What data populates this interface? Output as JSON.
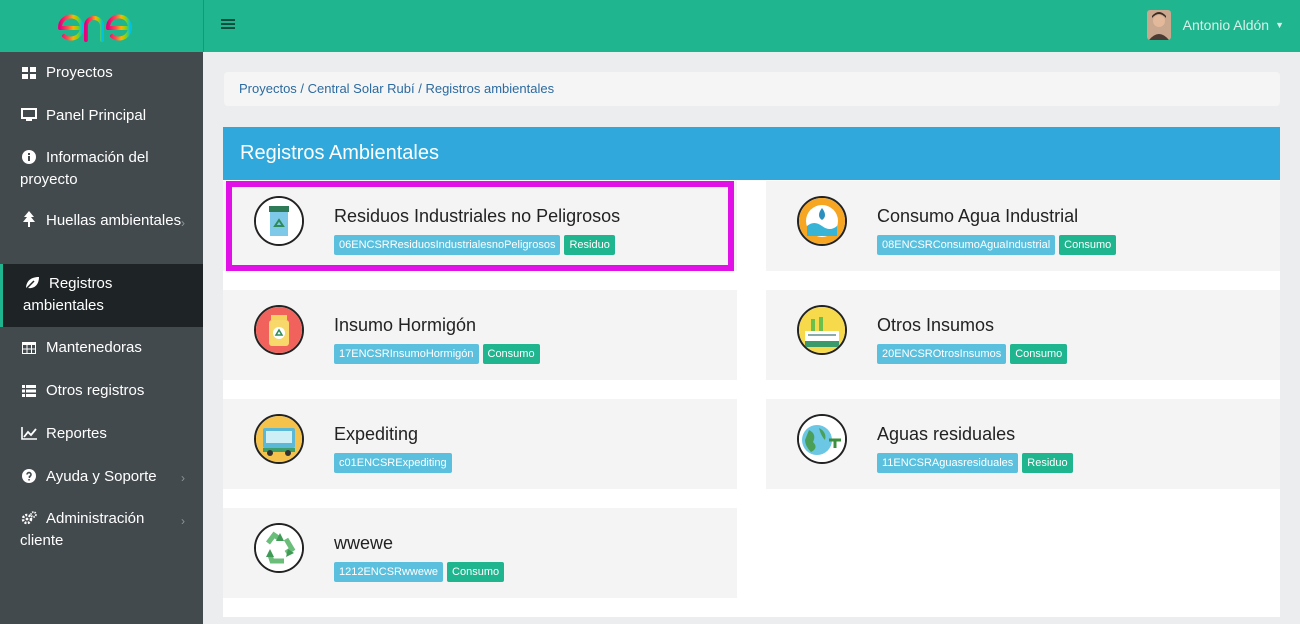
{
  "app": {
    "logo_text": "enel"
  },
  "topbar": {
    "user_name": "Antonio Aldón"
  },
  "sidebar": {
    "items": [
      {
        "label": "Proyectos",
        "icon": "grid-icon"
      },
      {
        "label": "Panel Principal",
        "icon": "monitor-icon"
      },
      {
        "label": "Información del proyecto",
        "icon": "info-icon"
      },
      {
        "label": "Huellas ambientales",
        "icon": "tree-icon"
      },
      {
        "label": "Registros ambientales",
        "icon": "leaf-icon"
      },
      {
        "label": "Mantenedoras",
        "icon": "table-icon"
      },
      {
        "label": "Otros registros",
        "icon": "list-icon"
      },
      {
        "label": "Reportes",
        "icon": "line-chart-icon"
      },
      {
        "label": "Ayuda y Soporte",
        "icon": "question-icon"
      },
      {
        "label": "Administración cliente",
        "icon": "gears-icon"
      }
    ]
  },
  "breadcrumb": {
    "items": [
      "Proyectos",
      "Central Solar Rubí",
      "Registros ambientales"
    ],
    "separator": " / "
  },
  "panel": {
    "title": "Registros Ambientales"
  },
  "records": [
    {
      "title": "Residuos Industriales no Peligrosos",
      "code": "06ENCSRResiduosIndustrialesnoPeligrosos",
      "type": "Residuo",
      "icon": "recycle-bin-icon"
    },
    {
      "title": "Consumo Agua Industrial",
      "code": "08ENCSRConsumoAguaIndustrial",
      "type": "Consumo",
      "icon": "water-drop-icon"
    },
    {
      "title": "Insumo Hormigón",
      "code": "17ENCSRInsumoHormigón",
      "type": "Consumo",
      "icon": "container-icon"
    },
    {
      "title": "Otros Insumos",
      "code": "20ENCSROtrosInsumos",
      "type": "Consumo",
      "icon": "factory-icon"
    },
    {
      "title": "Expediting",
      "code": "c01ENCSRExpediting",
      "type": "",
      "icon": "truck-icon"
    },
    {
      "title": "Aguas residuales",
      "code": "11ENCSRAguasresiduales",
      "type": "Residuo",
      "icon": "earth-pipe-icon"
    },
    {
      "title": "wwewe",
      "code": "1212ENCSRwwewe",
      "type": "Consumo",
      "icon": "recycle-arrows-icon"
    }
  ]
}
